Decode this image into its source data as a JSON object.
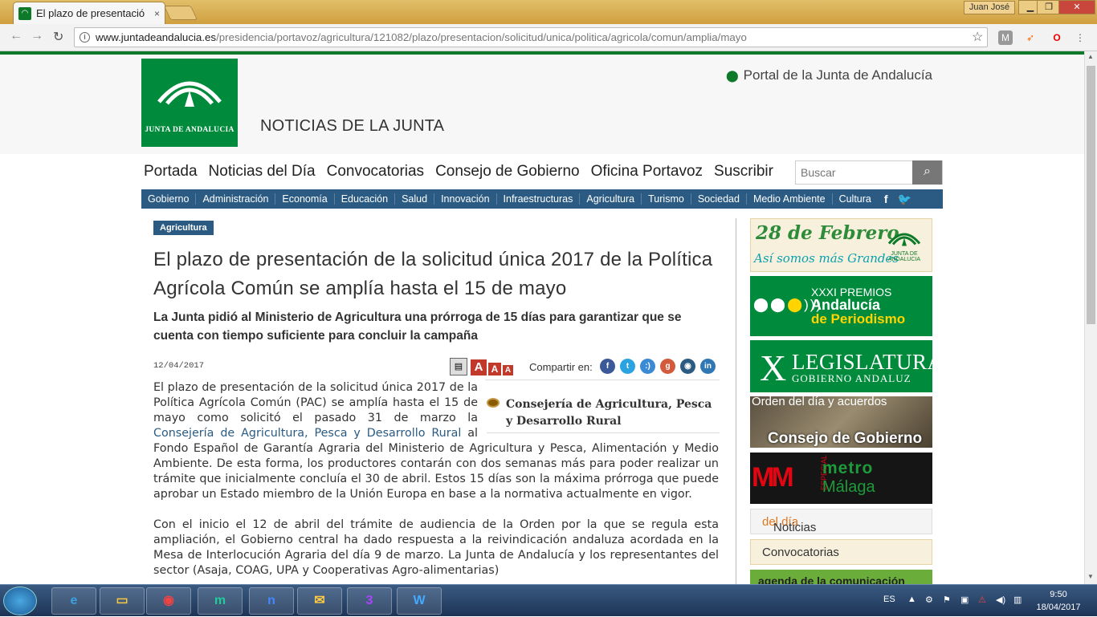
{
  "browser": {
    "tab_title": "El plazo de presentació",
    "tab_close": "×",
    "user_name": "Juan José",
    "window_buttons": [
      "▁",
      "❐",
      "✕"
    ],
    "url_host": "www.juntadeandalucia.es",
    "url_path": "/presidencia/portavoz/agricultura/121082/plazo/presentacion/solicitud/unica/politica/agricola/comun/amplia/mayo"
  },
  "header": {
    "logo_text": "JUNTA DE ANDALUCIA",
    "site_title": "NOTICIAS DE LA JUNTA",
    "portal_link": "Portal de la Junta de Andalucía"
  },
  "main_nav": [
    "Portada",
    "Noticias del Día",
    "Convocatorias",
    "Consejo de Gobierno",
    "Oficina Portavoz",
    "Suscribir"
  ],
  "search": {
    "placeholder": "Buscar"
  },
  "section_nav": [
    "Gobierno",
    "Administración",
    "Economía",
    "Educación",
    "Salud",
    "Innovación",
    "Infraestructuras",
    "Agricultura",
    "Turismo",
    "Sociedad",
    "Medio Ambiente",
    "Cultura"
  ],
  "section_active": "Agricultura",
  "article": {
    "category": "Agricultura",
    "headline": "El plazo de presentación de la solicitud única 2017 de la Política Agrícola Común se amplía hasta el 15 de mayo",
    "subheadline": "La Junta pidió al Ministerio de Agricultura una prórroga de 15 días para garantizar que se cuenta con tiempo suficiente para concluir la campaña",
    "date": "12/04/2017",
    "share_label": "Compartir en:",
    "department": "Consejería de Agricultura, Pesca y Desarrollo Rural",
    "p1_before": "El plazo de presentación de la solicitud única 2017 de la Política Agrícola Común (PAC) se amplía hasta el 15 de mayo como solicitó el pasado 31 de marzo la ",
    "p1_link": "Consejería de Agricultura, Pesca y Desarrollo Rural",
    "p1_after": " al Fondo Español de Garantía Agraria del Ministerio de Agricultura y Pesca, Alimentación y Medio Ambiente. De esta forma, los productores contarán con dos semanas más para poder realizar un trámite que inicialmente concluía el 30 de abril. Estos 15 días son la máxima prórroga que puede aprobar un Estado miembro de la Unión Europa en base a la normativa actualmente en vigor.",
    "p2": "Con el inicio el 12 de abril del trámite de audiencia de la Orden por la que se regula esta ampliación, el Gobierno central ha dado respuesta a la reivindicación andaluza acordada en la Mesa de Interlocución Agraria del día 9 de marzo. La Junta de Andalucía y los representantes del sector (Asaja, COAG, UPA y Cooperativas Agro-alimentarias)"
  },
  "sidebar": {
    "b1_line1": "28 de Febrero",
    "b1_line2": "Así somos más Grandes",
    "b1_logo": "JUNTA DE ANDALUCIA",
    "b2_line1": "XXXI PREMIOS",
    "b2_line2": "Andalucía",
    "b2_line3": "de Periodismo",
    "b3_x": "X",
    "b3_line1": "LEGISLATURA",
    "b3_line2": "GOBIERNO ANDALUZ",
    "b4_line1": "Orden del día y acuerdos",
    "b4_line2": "Consejo de Gobierno",
    "b5_logo": "MM",
    "b5_esp": "ESPECIAL",
    "b5_line1": "metro",
    "b5_line2": "Málaga",
    "b6_a": "Noticias ",
    "b6_b": "del día",
    "b7": "Convocatorias",
    "b8": "agenda de la comunicación"
  },
  "taskbar": {
    "lang": "ES",
    "time": "9:50",
    "date": "18/04/2017"
  },
  "colors": {
    "brand_green": "#008a3b",
    "nav_blue": "#2b5b83"
  }
}
